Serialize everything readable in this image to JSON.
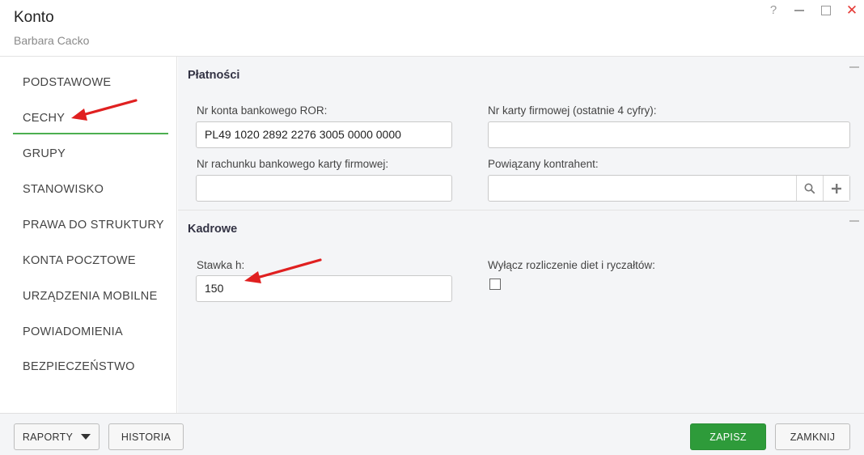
{
  "window": {
    "title": "Konto",
    "subtitle": "Barbara Cacko",
    "help_label": "?",
    "close_label": "✕"
  },
  "sidebar": {
    "items": [
      {
        "label": "PODSTAWOWE"
      },
      {
        "label": "CECHY",
        "active": true
      },
      {
        "label": "GRUPY"
      },
      {
        "label": "STANOWISKO"
      },
      {
        "label": "PRAWA DO STRUKTURY"
      },
      {
        "label": "KONTA POCZTOWE"
      },
      {
        "label": "URZĄDZENIA MOBILNE"
      },
      {
        "label": "POWIADOMIENIA"
      },
      {
        "label": "BEZPIECZEŃSTWO"
      }
    ]
  },
  "platnosci": {
    "title": "Płatności",
    "ror_label": "Nr konta bankowego ROR:",
    "ror_value": "PL49 1020 2892 2276 3005 0000 0000",
    "karta_label": "Nr karty firmowej (ostatnie 4 cyfry):",
    "karta_value": "",
    "rachunek_label": "Nr rachunku bankowego karty firmowej:",
    "rachunek_value": "",
    "kontrahent_label": "Powiązany kontrahent:",
    "kontrahent_value": ""
  },
  "kadrowe": {
    "title": "Kadrowe",
    "stawka_label": "Stawka h:",
    "stawka_value": "150",
    "wylacz_label": "Wyłącz rozliczenie diet i ryczałtów:",
    "wylacz_checked": false
  },
  "footer": {
    "raporty_label": "RAPORTY",
    "historia_label": "HISTORIA",
    "zapisz_label": "ZAPISZ",
    "zamknij_label": "ZAMKNIJ"
  },
  "colors": {
    "accent_green": "#2e9b3a",
    "active_underline": "#4caf50",
    "annotation_arrow": "#e02020",
    "close_red": "#e53935"
  }
}
